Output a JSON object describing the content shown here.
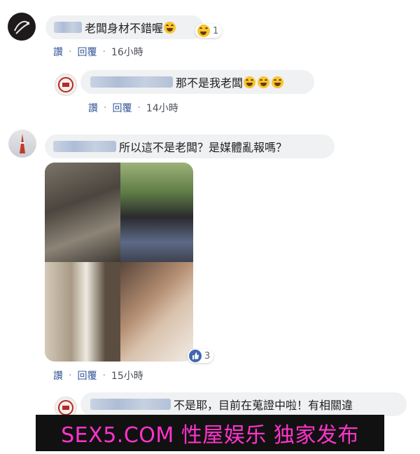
{
  "comments": [
    {
      "text": "老闆身材不錯喔",
      "reaction_count": "1",
      "actions": {
        "like": "讚",
        "reply": "回覆",
        "time": "16小時"
      }
    },
    {
      "text": "那不是我老闆",
      "actions": {
        "like": "讚",
        "reply": "回覆",
        "time": "14小時"
      }
    },
    {
      "text": "所以這不是老闆？是媒體亂報嗎？",
      "reaction_count": "3",
      "actions": {
        "like": "讚",
        "reply": "回覆",
        "time": "15小時"
      }
    },
    {
      "text": "不是耶，目前在蒐證中啦！有相關違"
    }
  ],
  "watermark": "SEX5.COM 性屋娱乐 独家发布",
  "colors": {
    "bubble": "#eff1f3",
    "link": "#385898",
    "like_blue": "#4267b2",
    "banner_text": "#ff33cc"
  }
}
